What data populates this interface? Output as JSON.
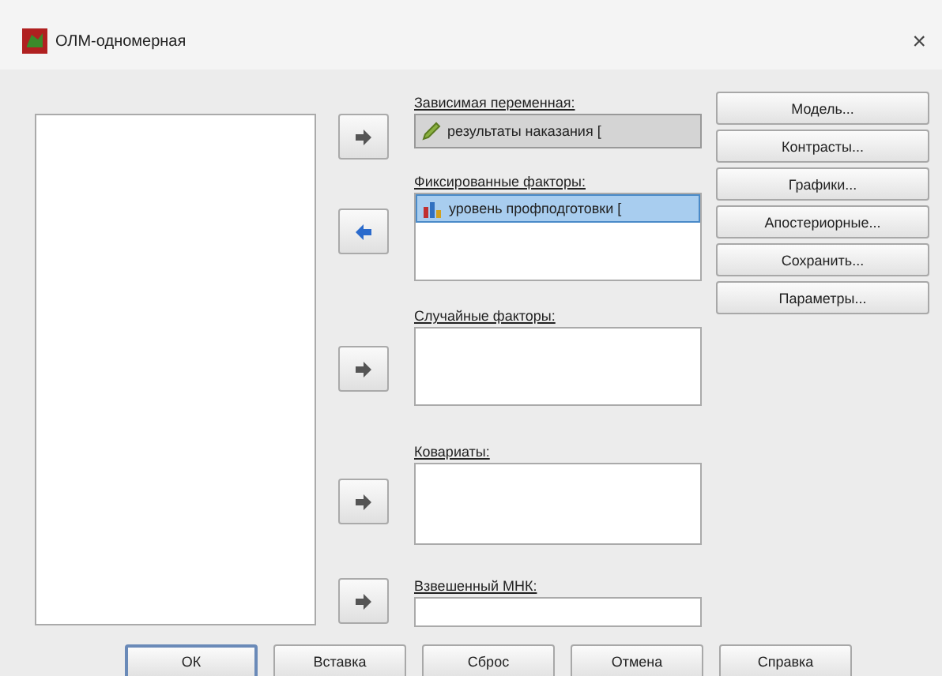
{
  "window": {
    "title": "ОЛМ-одномерная",
    "close": "×"
  },
  "arrow_buttons": [
    {
      "kind": "forward"
    },
    {
      "kind": "back"
    },
    {
      "kind": "forward"
    },
    {
      "kind": "forward"
    },
    {
      "kind": "forward"
    }
  ],
  "dependent": {
    "label": "Зависимая переменная:",
    "value": "результаты наказания ["
  },
  "fixed_factors": {
    "label": "Фиксированные факторы:",
    "items": [
      {
        "text": "уровень профподготовки [",
        "selected": true
      }
    ]
  },
  "random_factors": {
    "label": "Случайные факторы:"
  },
  "covariates": {
    "label": "Ковариаты:"
  },
  "wls": {
    "label": "Взвешенный МНК:"
  },
  "side_buttons": [
    "Модель...",
    "Контрасты...",
    "Графики...",
    "Апостериорные...",
    "Сохранить...",
    "Параметры..."
  ],
  "bottom_buttons": [
    {
      "label": "ОК",
      "default": true
    },
    {
      "label": "Вставка",
      "default": false
    },
    {
      "label": "Сброс",
      "default": false
    },
    {
      "label": "Отмена",
      "default": false
    },
    {
      "label": "Справка",
      "default": false
    }
  ]
}
